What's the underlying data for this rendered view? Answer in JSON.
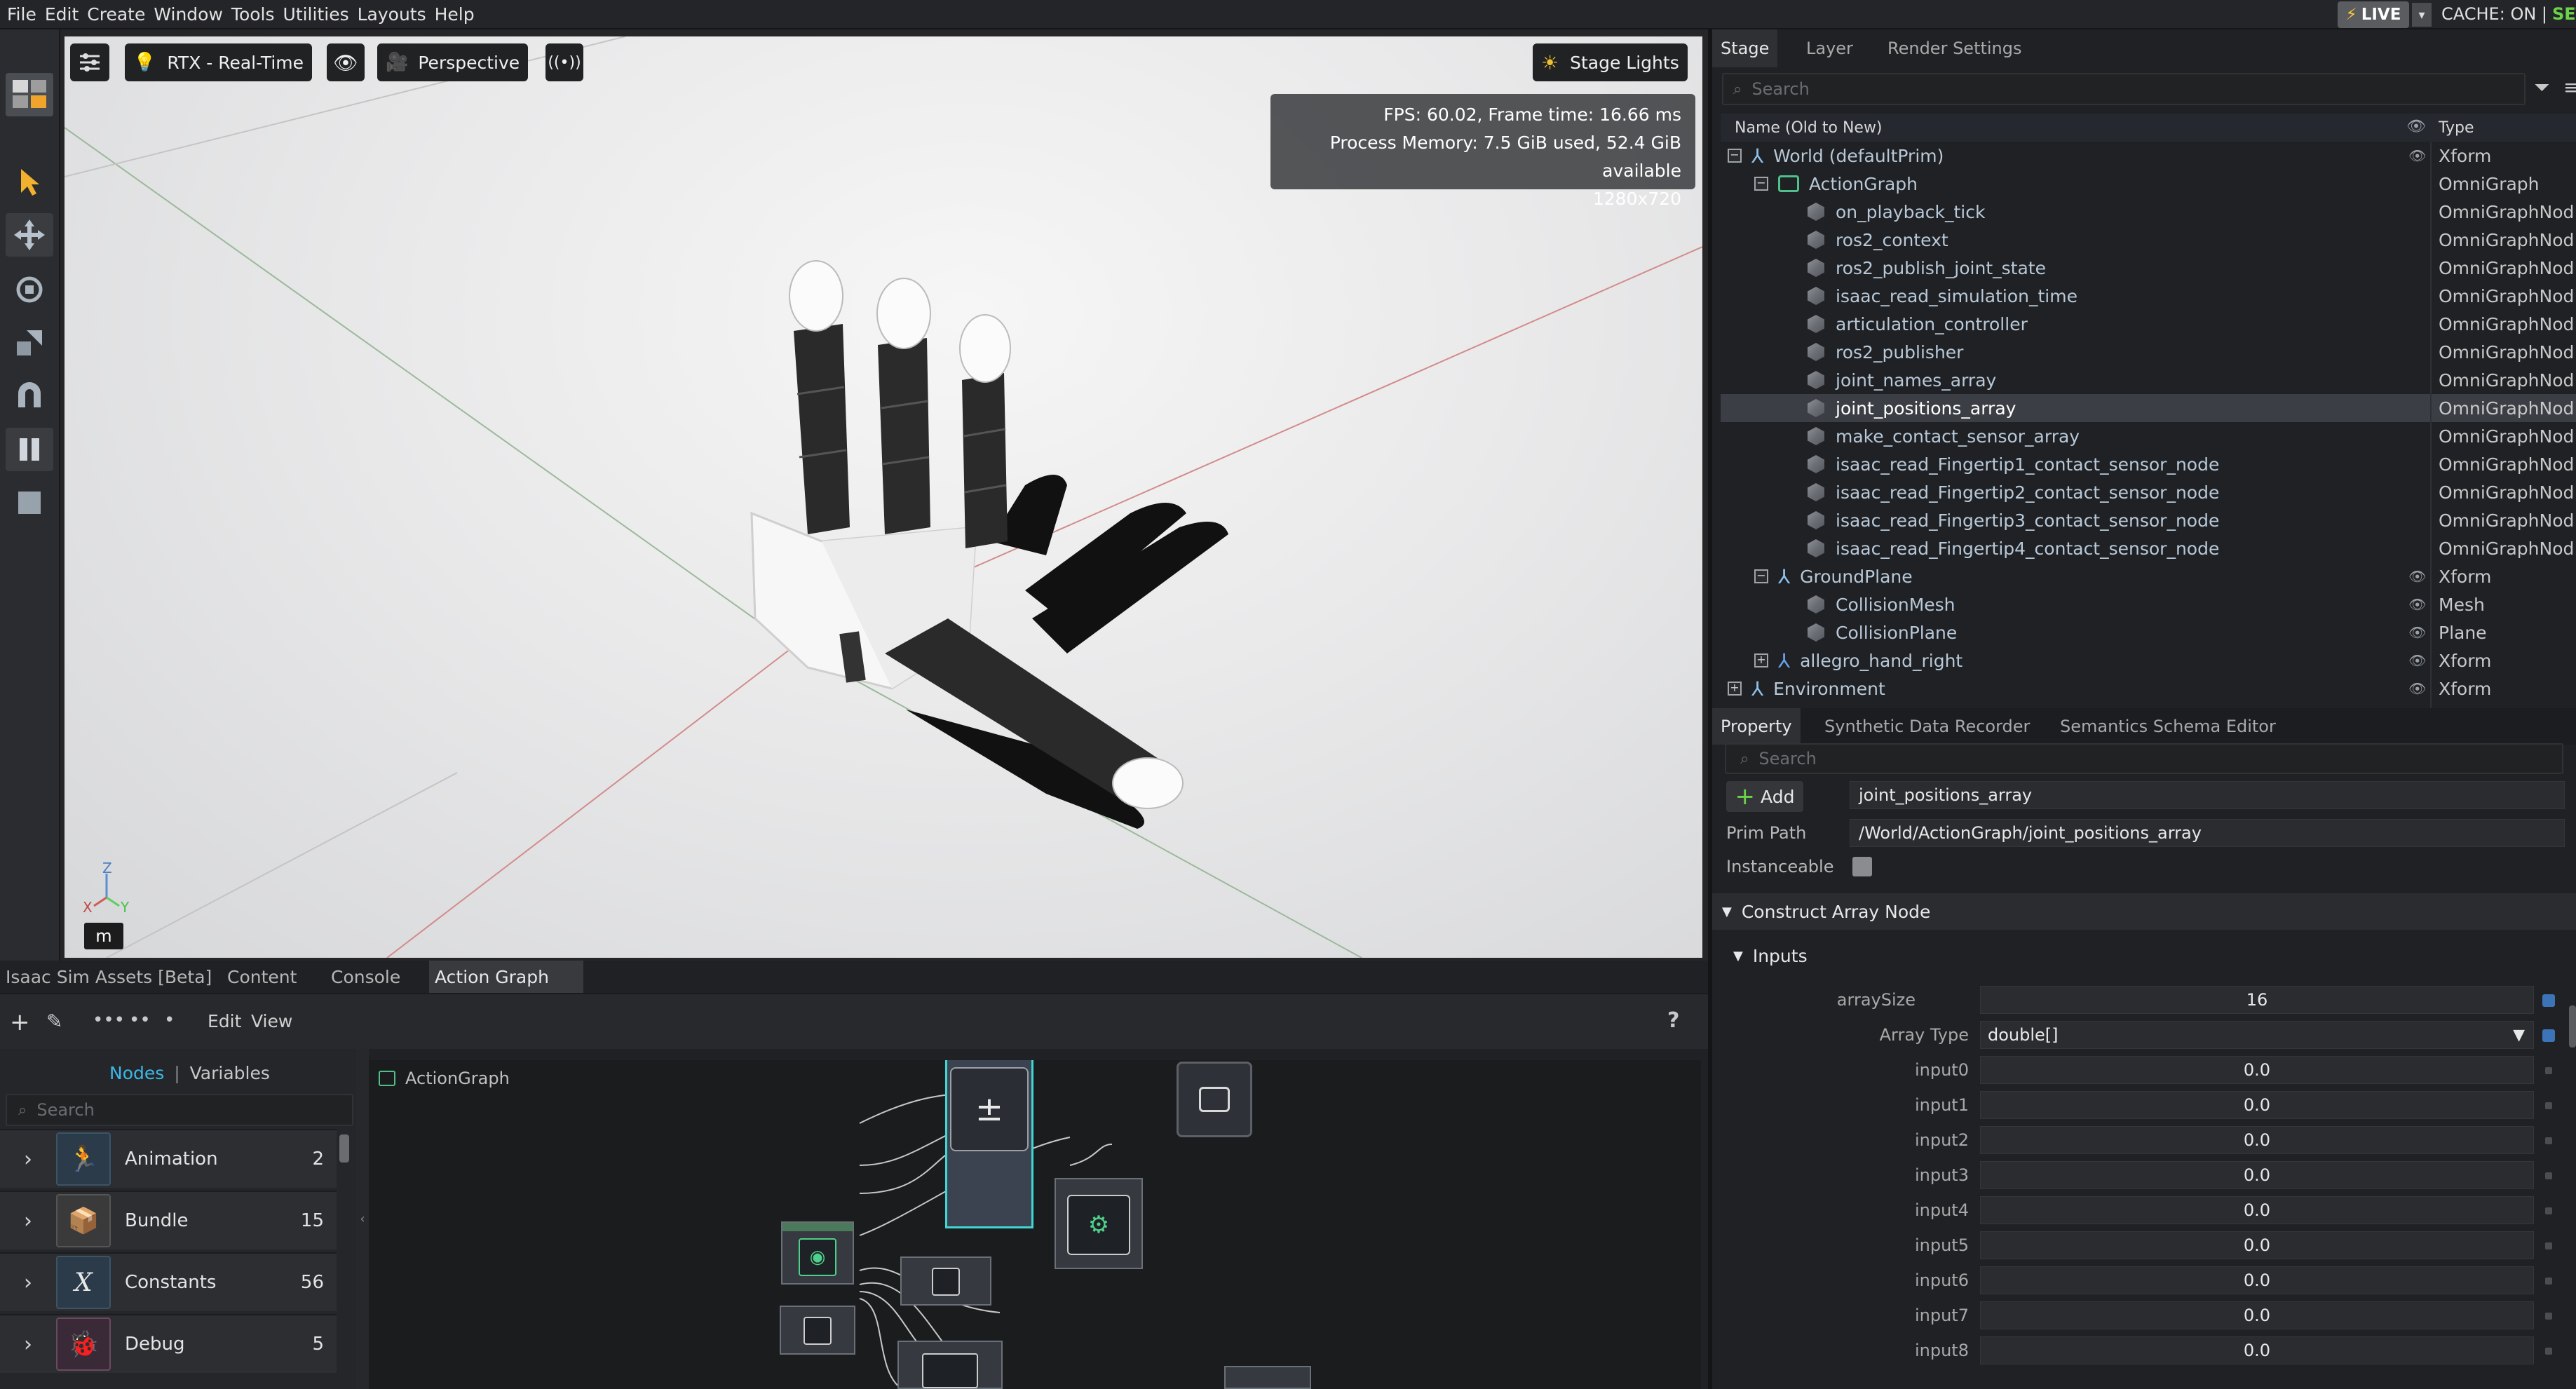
{
  "menu": [
    "File",
    "Edit",
    "Create",
    "Window",
    "Tools",
    "Utilities",
    "Layouts",
    "Help"
  ],
  "status": {
    "live": "LIVE",
    "cache": "CACHE: ON",
    "cache_sep": "|",
    "set": "SET"
  },
  "viewport": {
    "renderer": "RTX - Real-Time",
    "camera": "Perspective",
    "lights": "Stage Lights",
    "hud": {
      "fps": "FPS: 60.02, Frame time: 16.66 ms",
      "memory": "Process Memory: 7.5 GiB used, 52.4 GiB available",
      "resolution": "1280x720"
    },
    "axis_units": "m",
    "axes": {
      "z": "Z",
      "x": "X",
      "y": "Y"
    }
  },
  "bottom_tabs": [
    "Isaac Sim Assets [Beta]",
    "Content",
    "Console",
    "Action Graph"
  ],
  "bottom_active_tab": "Action Graph",
  "graph_toolbar": {
    "edit": "Edit",
    "view": "View",
    "help": "?"
  },
  "nodes_panel": {
    "tab_nodes": "Nodes",
    "sep": "|",
    "tab_variables": "Variables",
    "search": "Search",
    "categories": [
      {
        "name": "Animation",
        "count": "2"
      },
      {
        "name": "Bundle",
        "count": "15"
      },
      {
        "name": "Constants",
        "count": "56"
      },
      {
        "name": "Debug",
        "count": "5"
      }
    ]
  },
  "graph": {
    "title": "ActionGraph"
  },
  "stage_tabs": [
    "Stage",
    "Layer",
    "Render Settings"
  ],
  "stage": {
    "search": "Search",
    "col_name": "Name (Old to New)",
    "col_type": "Type",
    "rows": [
      {
        "name": "World (defaultPrim)",
        "type": "Xform"
      },
      {
        "name": "ActionGraph",
        "type": "OmniGraph"
      },
      {
        "name": "on_playback_tick",
        "type": "OmniGraphNod"
      },
      {
        "name": "ros2_context",
        "type": "OmniGraphNod"
      },
      {
        "name": "ros2_publish_joint_state",
        "type": "OmniGraphNod"
      },
      {
        "name": "isaac_read_simulation_time",
        "type": "OmniGraphNod"
      },
      {
        "name": "articulation_controller",
        "type": "OmniGraphNod"
      },
      {
        "name": "ros2_publisher",
        "type": "OmniGraphNod"
      },
      {
        "name": "joint_names_array",
        "type": "OmniGraphNod"
      },
      {
        "name": "joint_positions_array",
        "type": "OmniGraphNod"
      },
      {
        "name": "make_contact_sensor_array",
        "type": "OmniGraphNod"
      },
      {
        "name": "isaac_read_Fingertip1_contact_sensor_node",
        "type": "OmniGraphNod"
      },
      {
        "name": "isaac_read_Fingertip2_contact_sensor_node",
        "type": "OmniGraphNod"
      },
      {
        "name": "isaac_read_Fingertip3_contact_sensor_node",
        "type": "OmniGraphNod"
      },
      {
        "name": "isaac_read_Fingertip4_contact_sensor_node",
        "type": "OmniGraphNod"
      },
      {
        "name": "GroundPlane",
        "type": "Xform"
      },
      {
        "name": "CollisionMesh",
        "type": "Mesh"
      },
      {
        "name": "CollisionPlane",
        "type": "Plane"
      },
      {
        "name": "allegro_hand_right",
        "type": "Xform"
      },
      {
        "name": "Environment",
        "type": "Xform"
      }
    ]
  },
  "property_tabs": [
    "Property",
    "Synthetic Data Recorder",
    "Semantics Schema Editor"
  ],
  "property": {
    "search": "Search",
    "add": "Add",
    "name_value": "joint_positions_array",
    "prim_path_label": "Prim Path",
    "prim_path": "/World/ActionGraph/joint_positions_array",
    "instanceable_label": "Instanceable",
    "section": "Construct Array Node",
    "inputs_label": "Inputs",
    "array_size_label": "arraySize",
    "array_size": "16",
    "array_type_label": "Array Type",
    "array_type": "double[]",
    "inputs": [
      {
        "label": "input0",
        "value": "0.0"
      },
      {
        "label": "input1",
        "value": "0.0"
      },
      {
        "label": "input2",
        "value": "0.0"
      },
      {
        "label": "input3",
        "value": "0.0"
      },
      {
        "label": "input4",
        "value": "0.0"
      },
      {
        "label": "input5",
        "value": "0.0"
      },
      {
        "label": "input6",
        "value": "0.0"
      },
      {
        "label": "input7",
        "value": "0.0"
      },
      {
        "label": "input8",
        "value": "0.0"
      }
    ]
  },
  "colors": {
    "accent": "#6cd24a",
    "selected": "#3b3f45",
    "link": "#3db8e8"
  }
}
